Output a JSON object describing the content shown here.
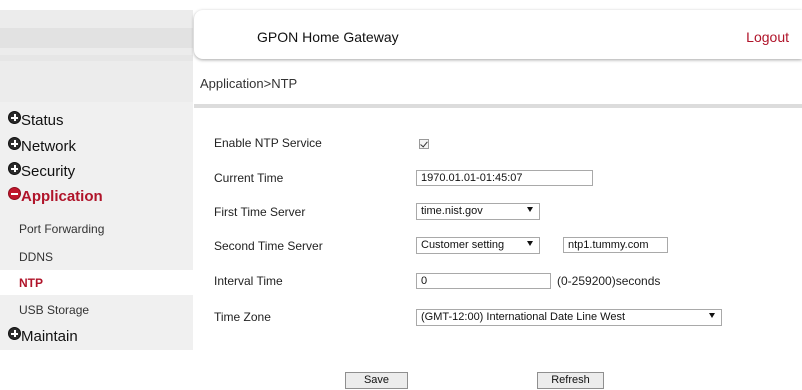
{
  "header": {
    "title": "GPON Home Gateway",
    "logout_label": "Logout"
  },
  "breadcrumb": "Application>NTP",
  "sidebar": {
    "sections": [
      {
        "label": "Status",
        "icon": "plus-icon"
      },
      {
        "label": "Network",
        "icon": "plus-icon"
      },
      {
        "label": "Security",
        "icon": "plus-icon"
      },
      {
        "label": "Application",
        "icon": "minus-icon",
        "active": true
      },
      {
        "label": "Maintain",
        "icon": "plus-icon"
      }
    ],
    "application_items": [
      {
        "label": "Port Forwarding"
      },
      {
        "label": "DDNS"
      },
      {
        "label": "NTP",
        "current": true
      },
      {
        "label": "USB Storage"
      }
    ]
  },
  "form": {
    "enable_ntp": {
      "label": "Enable NTP Service",
      "checked": true
    },
    "current_time": {
      "label": "Current Time",
      "value": "1970.01.01-01:45:07"
    },
    "first_time_server": {
      "label": "First Time Server",
      "selected": "time.nist.gov"
    },
    "second_time_server": {
      "label": "Second Time Server",
      "selected": "Customer setting",
      "custom_value": "ntp1.tummy.com"
    },
    "interval_time": {
      "label": "Interval Time",
      "value": "0",
      "unit": "(0-259200)seconds"
    },
    "time_zone": {
      "label": "Time Zone",
      "selected": "(GMT-12:00) International Date Line West"
    }
  },
  "buttons": {
    "save_label": "Save",
    "refresh_label": "Refresh"
  },
  "colors": {
    "accent_red": "#b0142a",
    "sidebar_bg": "#f0f0f0"
  }
}
